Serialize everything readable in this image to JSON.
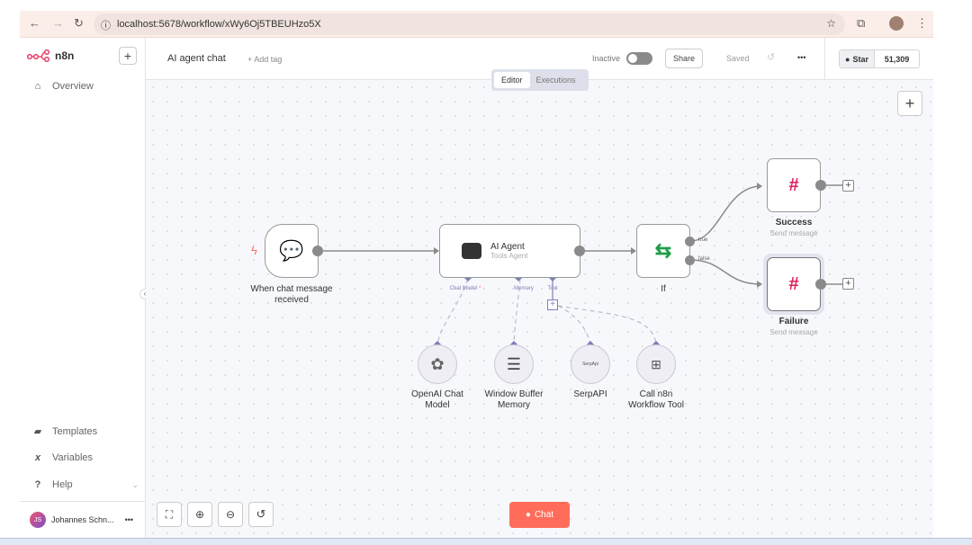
{
  "browser": {
    "url": "localhost:5678/workflow/xWy6Oj5TBEUHzo5X"
  },
  "app": {
    "logo": "n8n",
    "workflow_title": "AI agent chat",
    "add_tag": "+ Add tag",
    "status": "Inactive",
    "active": false,
    "share": "Share",
    "saved": "Saved",
    "star": "Star",
    "star_count": "51,309"
  },
  "tabs": {
    "editor": "Editor",
    "executions": "Executions",
    "active": "Editor"
  },
  "sidebar": {
    "items": [
      {
        "label": "Overview",
        "icon": "home-icon"
      },
      {
        "label": "Templates",
        "icon": "box-icon"
      },
      {
        "label": "Variables",
        "icon": "variable-icon"
      },
      {
        "label": "Help",
        "icon": "question-icon"
      }
    ],
    "user": {
      "initials": "JS",
      "name": "Johannes Schn..."
    }
  },
  "nodes": {
    "trigger": {
      "title": "When chat message",
      "title2": "received"
    },
    "agent": {
      "title": "AI Agent",
      "subtitle": "Tools Agent",
      "ports": {
        "chat_model": "Chat Model",
        "required": "*",
        "memory": "Memory",
        "tool": "Tool"
      }
    },
    "if": {
      "title": "If",
      "true": "true",
      "false": "false"
    },
    "success": {
      "title": "Success",
      "subtitle": "Send message"
    },
    "failure": {
      "title": "Failure",
      "subtitle": "Send message"
    },
    "openai": {
      "title": "OpenAI Chat",
      "title2": "Model"
    },
    "memory": {
      "title": "Window Buffer",
      "title2": "Memory"
    },
    "serpapi": {
      "title": "SerpAPI",
      "logo": "SerpApi"
    },
    "workflow_tool": {
      "title": "Call n8n",
      "title2": "Workflow Tool"
    }
  },
  "footer": {
    "chat": "Chat"
  },
  "colors": {
    "accent": "#ff6d5a",
    "port": "#7a7fb8",
    "if_green": "#1e9e4a"
  }
}
